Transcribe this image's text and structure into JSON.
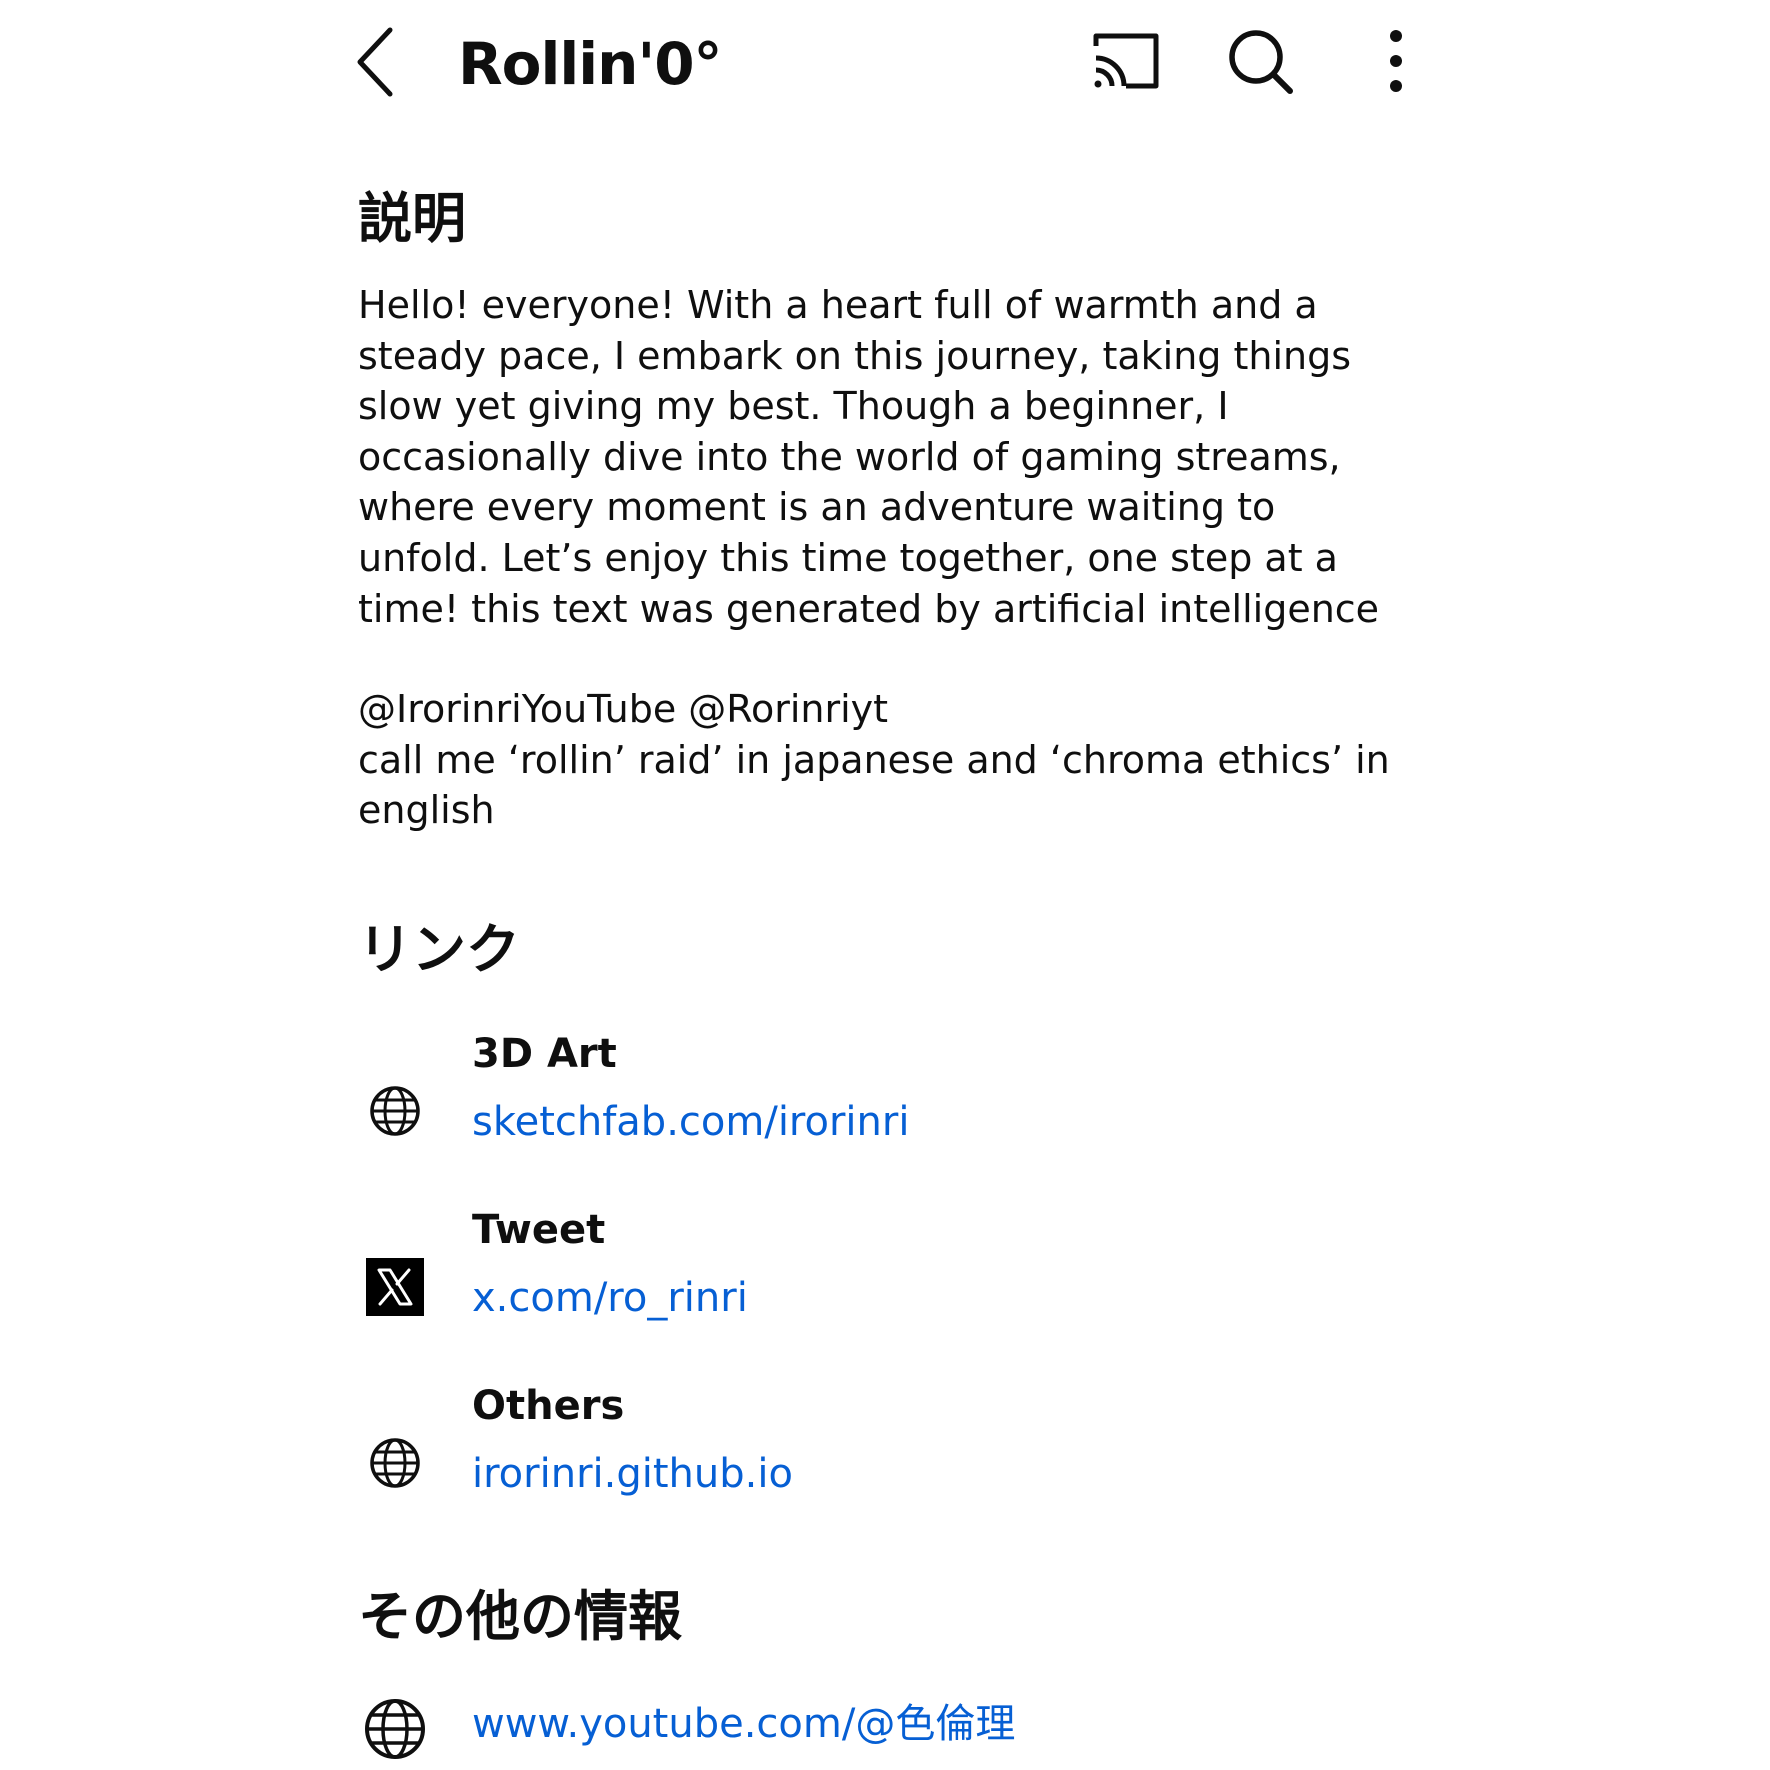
{
  "header": {
    "title": "Rollin'0°",
    "icons": [
      "chevron-left-icon",
      "cast-icon",
      "search-icon",
      "more-vert-icon"
    ]
  },
  "description": {
    "heading": "説明",
    "paragraph1": "Hello! everyone! With a heart full of warmth and a\nsteady pace, I embark on this journey, taking things\nslow yet giving my best. Though a beginner, I\noccasionally dive into the world of gaming streams,\nwhere every moment is an adventure waiting to\nunfold. Let’s enjoy this time together, one step at a\ntime! this text was generated by artificial intelligence",
    "paragraph2": "@IrorinriYouTube @Rorinriyt\ncall me ‘rollin’ raid’ in japanese and ‘chroma ethics’ in\nenglish"
  },
  "links": {
    "heading": "リンク",
    "items": [
      {
        "title": "3D Art",
        "url": "sketchfab.com/irorinri",
        "icon": "globe-icon"
      },
      {
        "title": "Tweet",
        "url": "x.com/ro_rinri",
        "icon": "x-logo-icon"
      },
      {
        "title": "Others",
        "url": "irorinri.github.io",
        "icon": "globe-icon"
      }
    ]
  },
  "other_info": {
    "heading": "その他の情報",
    "url": "www.youtube.com/@色倫理",
    "icon": "globe-icon"
  },
  "colors": {
    "text": "#0f0f0f",
    "link": "#065fd4",
    "background": "#ffffff"
  }
}
